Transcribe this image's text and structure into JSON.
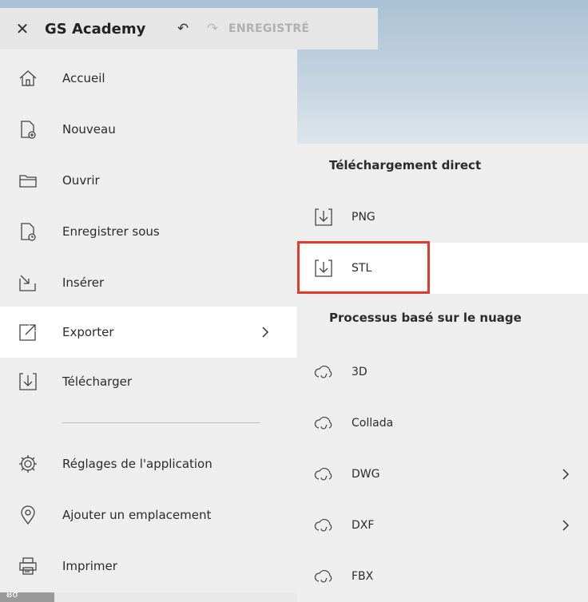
{
  "toolbar": {
    "title": "GS Academy",
    "status": "ENREGISTRÉ",
    "close_icon": "close-icon",
    "undo_icon": "undo-icon",
    "redo_icon": "redo-icon"
  },
  "menu": {
    "items": [
      {
        "label": "Accueil",
        "icon": "home-icon"
      },
      {
        "label": "Nouveau",
        "icon": "new-file-icon"
      },
      {
        "label": "Ouvrir",
        "icon": "folder-icon"
      },
      {
        "label": "Enregistrer sous",
        "icon": "save-as-icon"
      },
      {
        "label": "Insérer",
        "icon": "insert-icon"
      },
      {
        "label": "Exporter",
        "icon": "export-icon"
      },
      {
        "label": "Télécharger",
        "icon": "download-icon"
      },
      {
        "label": "Réglages de l'application",
        "icon": "settings-icon"
      },
      {
        "label": "Ajouter un emplacement",
        "icon": "location-icon"
      },
      {
        "label": "Imprimer",
        "icon": "printer-icon"
      }
    ]
  },
  "submenu": {
    "direct_header": "Téléchargement direct",
    "direct_items": [
      {
        "label": "PNG",
        "icon": "download-icon"
      },
      {
        "label": "STL",
        "icon": "download-icon"
      }
    ],
    "cloud_header": "Processus basé sur le nuage",
    "cloud_items": [
      {
        "label": "3D",
        "icon": "cloud-sync-icon"
      },
      {
        "label": "Collada",
        "icon": "cloud-sync-icon"
      },
      {
        "label": "DWG",
        "icon": "cloud-sync-icon"
      },
      {
        "label": "DXF",
        "icon": "cloud-sync-icon"
      },
      {
        "label": "FBX",
        "icon": "cloud-sync-icon"
      }
    ]
  },
  "colors": {
    "highlight": "#e53a2a",
    "menu_bg": "#eeeeee",
    "active_bg": "#ffffff"
  }
}
